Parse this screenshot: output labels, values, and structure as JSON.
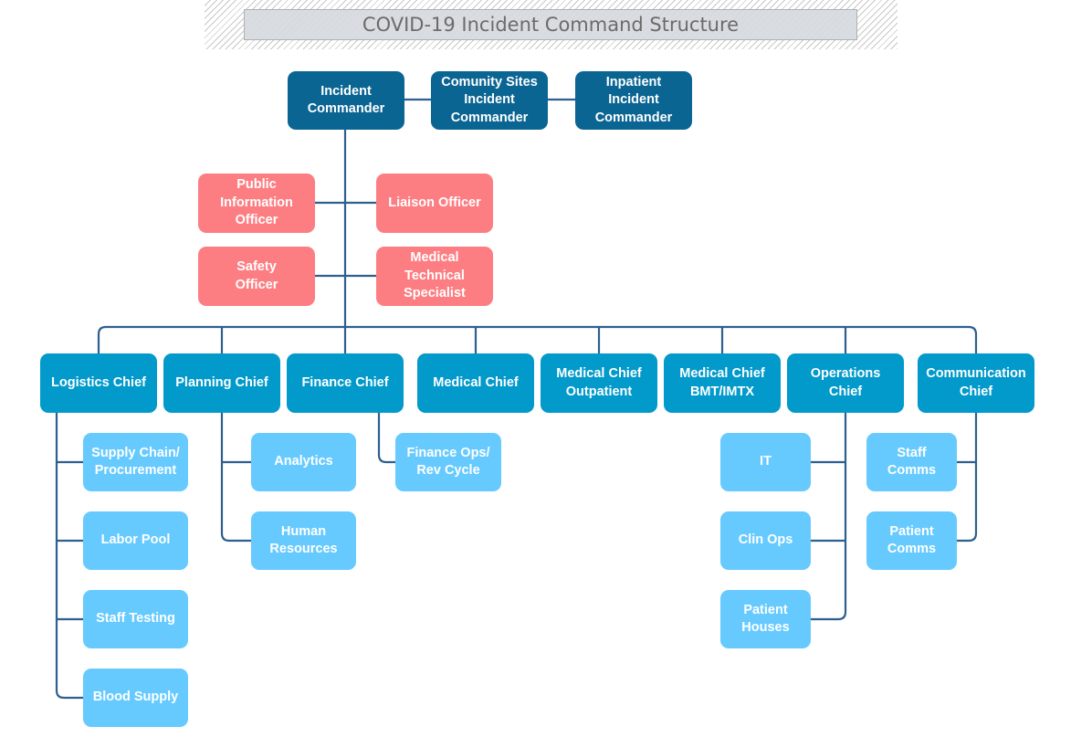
{
  "title": "COVID-19 Incident Command Structure",
  "colors": {
    "command": "#0b6593",
    "staff_officer": "#fd7e82",
    "section_chief": "#0299cb",
    "unit": "#66caff",
    "connector": "#2e5f8e",
    "title_bg": "#d6dade",
    "title_text": "#6b6b6b"
  },
  "command": {
    "incident_commander": "Incident\nCommander",
    "community_sites_commander": "Comunity Sites\nIncident\nCommander",
    "inpatient_commander": "Inpatient\nIncident\nCommander"
  },
  "staff_officers": {
    "public_information_officer": "Public\nInformation\nOfficer",
    "liaison_officer": "Liaison Officer",
    "safety_officer": "Safety\nOfficer",
    "medical_technical_specialist": "Medical\nTechnical\nSpecialist"
  },
  "chiefs": [
    {
      "label": "Logistics Chief",
      "units": [
        "Supply Chain/\nProcurement",
        "Labor Pool",
        "Staff Testing",
        "Blood Supply"
      ]
    },
    {
      "label": "Planning Chief",
      "units": [
        "Analytics",
        "Human\nResources"
      ]
    },
    {
      "label": "Finance Chief",
      "units": [
        "Finance Ops/\nRev Cycle"
      ]
    },
    {
      "label": "Medical Chief",
      "units": []
    },
    {
      "label": "Medical Chief\nOutpatient",
      "units": []
    },
    {
      "label": "Medical Chief\nBMT/IMTX",
      "units": []
    },
    {
      "label": "Operations\nChief",
      "units": [
        "IT",
        "Clin Ops",
        "Patient\nHouses"
      ]
    },
    {
      "label": "Communication\nChief",
      "units": [
        "Staff\nComms",
        "Patient\nComms"
      ]
    }
  ]
}
